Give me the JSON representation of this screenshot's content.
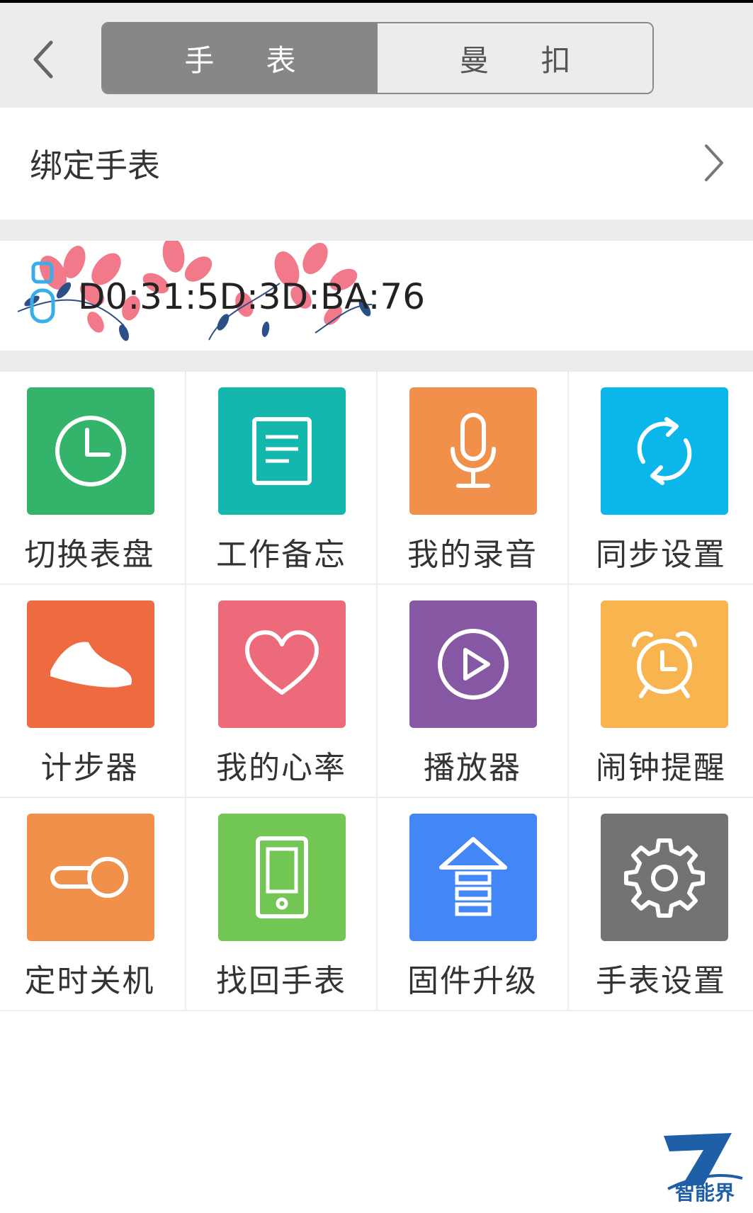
{
  "header": {
    "tabs": [
      {
        "label": "手 表",
        "active": true
      },
      {
        "label": "曼 扣",
        "active": false
      }
    ]
  },
  "bind": {
    "label": "绑定手表"
  },
  "device": {
    "mac": "D0:31:5D:3D:BA:76"
  },
  "features": [
    {
      "label": "切换表盘",
      "icon": "clock-icon",
      "color": "#34b36b"
    },
    {
      "label": "工作备忘",
      "icon": "memo-icon",
      "color": "#14b7ad"
    },
    {
      "label": "我的录音",
      "icon": "microphone-icon",
      "color": "#f0904a"
    },
    {
      "label": "同步设置",
      "icon": "sync-icon",
      "color": "#0ab6ea"
    },
    {
      "label": "计步器",
      "icon": "sneaker-icon",
      "color": "#ee6a40"
    },
    {
      "label": "我的心率",
      "icon": "heart-icon",
      "color": "#ec6a7a"
    },
    {
      "label": "播放器",
      "icon": "play-icon",
      "color": "#8657a3"
    },
    {
      "label": "闹钟提醒",
      "icon": "alarm-clock-icon",
      "color": "#f8b44f"
    },
    {
      "label": "定时关机",
      "icon": "toggle-icon",
      "color": "#f0904a"
    },
    {
      "label": "找回手表",
      "icon": "phone-icon",
      "color": "#72c654"
    },
    {
      "label": "固件升级",
      "icon": "upgrade-icon",
      "color": "#4287f5"
    },
    {
      "label": "手表设置",
      "icon": "gear-icon",
      "color": "#737373"
    }
  ],
  "watermark": {
    "text": "智能界"
  }
}
